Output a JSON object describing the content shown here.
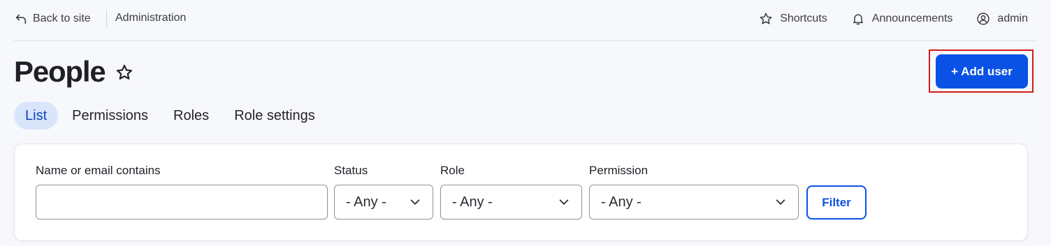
{
  "topbar": {
    "back_label": "Back to site",
    "breadcrumb": "Administration",
    "shortcuts_label": "Shortcuts",
    "announcements_label": "Announcements",
    "user_label": "admin"
  },
  "page": {
    "title": "People",
    "add_user_label": "+ Add user"
  },
  "tabs": [
    {
      "label": "List",
      "active": true
    },
    {
      "label": "Permissions",
      "active": false
    },
    {
      "label": "Roles",
      "active": false
    },
    {
      "label": "Role settings",
      "active": false
    }
  ],
  "filters": {
    "name_label": "Name or email contains",
    "name_value": "",
    "status_label": "Status",
    "status_value": "- Any -",
    "role_label": "Role",
    "role_value": "- Any -",
    "permission_label": "Permission",
    "permission_value": "- Any -",
    "filter_button_label": "Filter"
  },
  "colors": {
    "primary": "#0a52e6",
    "active_tab_bg": "#d9e5fb",
    "highlight_frame": "#d31a1a"
  }
}
